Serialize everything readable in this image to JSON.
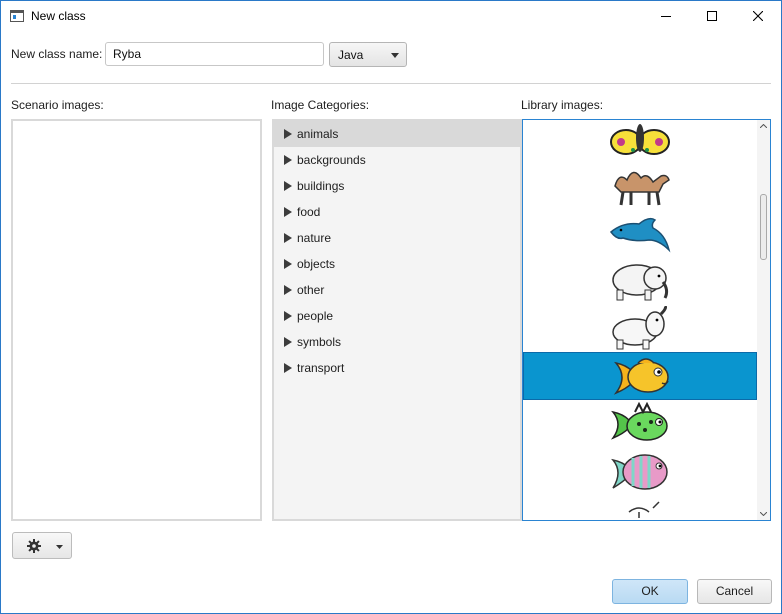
{
  "window": {
    "title": "New class"
  },
  "form": {
    "class_name_label": "New class name:",
    "class_name_value": "Ryba",
    "language_value": "Java"
  },
  "panels": {
    "scenario_label": "Scenario images:",
    "categories_label": "Image Categories:",
    "library_label": "Library images:"
  },
  "categories": [
    {
      "label": "animals",
      "selected": true
    },
    {
      "label": "backgrounds",
      "selected": false
    },
    {
      "label": "buildings",
      "selected": false
    },
    {
      "label": "food",
      "selected": false
    },
    {
      "label": "nature",
      "selected": false
    },
    {
      "label": "objects",
      "selected": false
    },
    {
      "label": "other",
      "selected": false
    },
    {
      "label": "people",
      "selected": false
    },
    {
      "label": "symbols",
      "selected": false
    },
    {
      "label": "transport",
      "selected": false
    }
  ],
  "library_images": [
    {
      "icon": "butterfly-icon",
      "selected": false
    },
    {
      "icon": "camel-icon",
      "selected": false
    },
    {
      "icon": "dolphin-icon",
      "selected": false
    },
    {
      "icon": "elephant-icon",
      "selected": false
    },
    {
      "icon": "elephant-2-icon",
      "selected": false
    },
    {
      "icon": "fish-icon",
      "selected": true
    },
    {
      "icon": "fish-2-icon",
      "selected": false
    },
    {
      "icon": "fish-3-icon",
      "selected": false
    },
    {
      "icon": "fly-icon",
      "selected": false
    }
  ],
  "buttons": {
    "ok": "OK",
    "cancel": "Cancel"
  },
  "colors": {
    "accent": "#0a95cf",
    "window_border": "#2a79c8",
    "ok_button": "#cfe6f8"
  }
}
